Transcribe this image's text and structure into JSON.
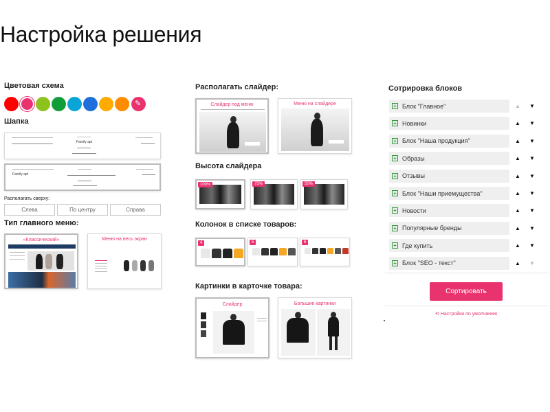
{
  "page": {
    "title": "Настройка решения"
  },
  "color_scheme": {
    "label": "Цветовая схема",
    "swatches": [
      {
        "name": "red",
        "color": "#ff0000"
      },
      {
        "name": "crimson",
        "color": "#e8336f",
        "selected": true
      },
      {
        "name": "lime",
        "color": "#8dc21f"
      },
      {
        "name": "green",
        "color": "#119e38"
      },
      {
        "name": "cyan",
        "color": "#0ba4d6"
      },
      {
        "name": "blue",
        "color": "#1e6fdc"
      },
      {
        "name": "amber",
        "color": "#ffab00"
      },
      {
        "name": "orange",
        "color": "#ff8c00"
      },
      {
        "name": "custom",
        "color": "#e8336f",
        "icon": "pencil-icon"
      }
    ]
  },
  "header_section": {
    "label": "Шапка",
    "position_label": "Располагать сверху:",
    "positions": [
      "Слева",
      "По центру",
      "Справа"
    ]
  },
  "main_menu": {
    "label": "Тип главного меню:",
    "options": [
      "«Классический»",
      "Меню на весь экран"
    ]
  },
  "slider": {
    "label": "Располагать слайдер:",
    "options": [
      "Слайдер под меню",
      "Меню на слайдере"
    ]
  },
  "slider_height": {
    "label": "Высота слайдера",
    "options": [
      "100%",
      "75%",
      "50%"
    ]
  },
  "columns": {
    "label": "Колонок в списке товаров:",
    "options": [
      "4",
      "5",
      "6"
    ]
  },
  "product_images": {
    "label": "Картинки в карточке товара:",
    "options": [
      "Слайдер",
      "Большие картинки"
    ]
  },
  "sorting": {
    "label": "Сотрировка блоков",
    "blocks": [
      "Блок \"Главное\"",
      "Новинки",
      "Блок \"Наша продукция\"",
      "Образы",
      "Отзывы",
      "Блок \"Наши приемущества\"",
      "Новости",
      "Популярные бренды",
      "Где купить",
      "Блок \"SEO - текст\""
    ],
    "button": "Сортировать",
    "reset": "Настройки по умолчанию"
  }
}
